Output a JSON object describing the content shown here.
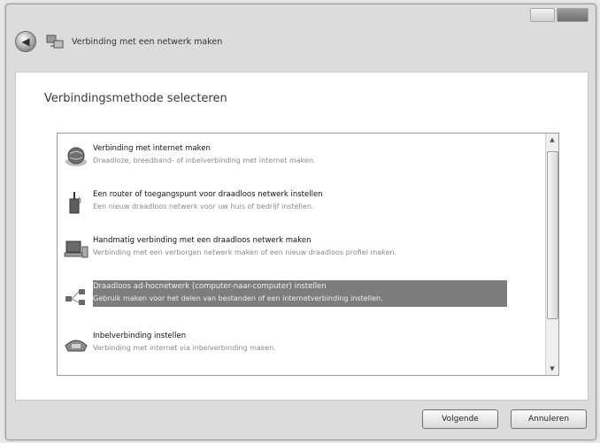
{
  "window": {
    "title": "Verbinding met een netwerk maken"
  },
  "page": {
    "heading": "Verbindingsmethode selecteren"
  },
  "options": [
    {
      "icon": "globe-icon",
      "title": "Verbinding met internet maken",
      "description": "Draadloze, breedband- of inbelverbinding met internet maken."
    },
    {
      "icon": "router-icon",
      "title": "Een router of toegangspunt voor draadloos netwerk instellen",
      "description": "Een nieuw draadloos netwerk voor uw huis of bedrijf instellen."
    },
    {
      "icon": "wireless-computer-icon",
      "title": "Handmatig verbinding met een draadloos netwerk maken",
      "description": "Verbinding met een verborgen netwerk maken of een nieuw draadloos profiel maken."
    },
    {
      "icon": "adhoc-network-icon",
      "title": "Draadloos ad-hocnetwerk (computer-naar-computer) instellen",
      "description": "Gebruik maken voor het delen van bestanden of een internetverbinding instellen.",
      "selected": true
    },
    {
      "icon": "dialup-phone-icon",
      "title": "Inbelverbinding instellen",
      "description": "Verbinding met internet via inbelverbinding maken."
    }
  ],
  "buttons": {
    "next": "Volgende",
    "cancel": "Annuleren"
  }
}
